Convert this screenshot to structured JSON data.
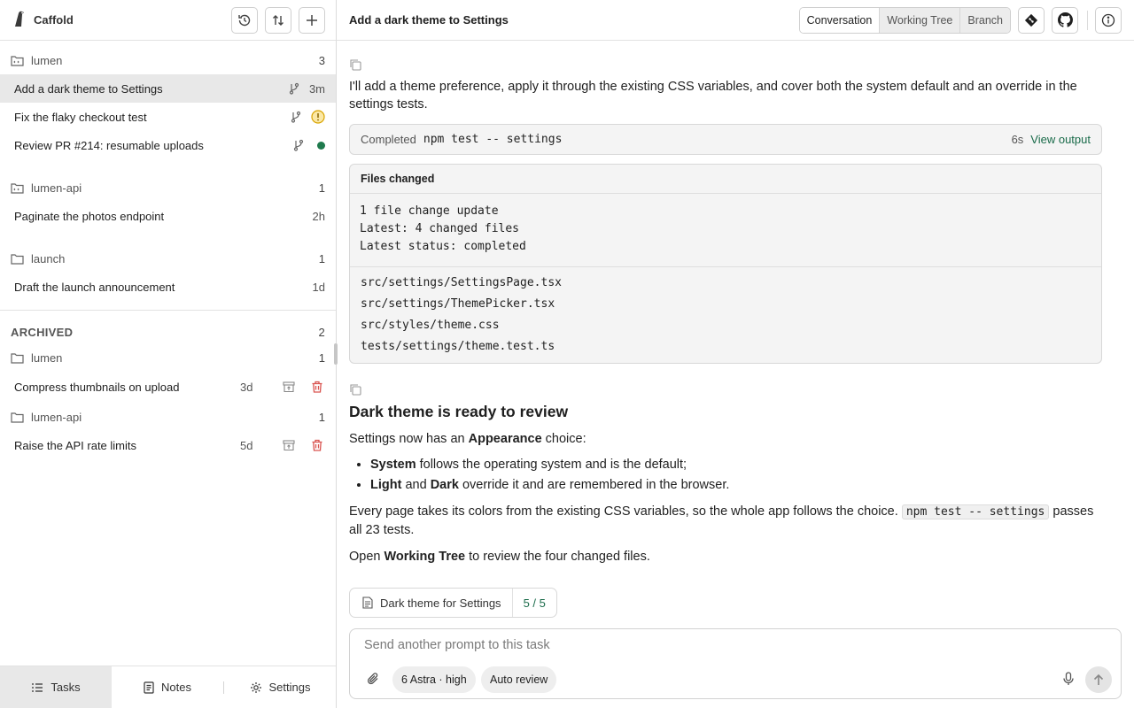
{
  "app": {
    "name": "Caffold"
  },
  "sidebar": {
    "groups": [
      {
        "name": "lumen",
        "count": "3",
        "tasks": [
          {
            "title": "Add a dark theme to Settings",
            "meta": "3m",
            "status": "none"
          },
          {
            "title": "Fix the flaky checkout test",
            "meta": "",
            "status": "warning"
          },
          {
            "title": "Review PR #214: resumable uploads",
            "meta": "",
            "status": "done"
          }
        ]
      },
      {
        "name": "lumen-api",
        "count": "1",
        "tasks": [
          {
            "title": "Paginate the photos endpoint",
            "meta": "2h"
          }
        ]
      },
      {
        "name": "launch",
        "count": "1",
        "tasks": [
          {
            "title": "Draft the launch announcement",
            "meta": "1d"
          }
        ]
      }
    ],
    "archived": {
      "label": "ARCHIVED",
      "count": "2",
      "groups": [
        {
          "name": "lumen",
          "count": "1",
          "tasks": [
            {
              "title": "Compress thumbnails on upload",
              "meta": "3d"
            }
          ]
        },
        {
          "name": "lumen-api",
          "count": "1",
          "tasks": [
            {
              "title": "Raise the API rate limits",
              "meta": "5d"
            }
          ]
        }
      ]
    },
    "footer": {
      "tasks": "Tasks",
      "notes": "Notes",
      "settings": "Settings"
    }
  },
  "header": {
    "title": "Add a dark theme to Settings",
    "tabs": [
      "Conversation",
      "Working Tree",
      "Branch"
    ],
    "active_tab": "Conversation"
  },
  "conversation": {
    "intro": "I'll add a theme preference, apply it through the existing CSS variables, and cover both the system default and an override in the settings tests.",
    "command": {
      "status": "Completed",
      "cmd": "npm test -- settings",
      "time": "6s",
      "link": "View output"
    },
    "files": {
      "header": "Files changed",
      "summary": [
        "1 file change update",
        "Latest: 4 changed files",
        "Latest status: completed"
      ],
      "list": [
        "src/settings/SettingsPage.tsx",
        "src/settings/ThemePicker.tsx",
        "src/styles/theme.css",
        "tests/settings/theme.test.ts"
      ]
    },
    "heading": "Dark theme is ready to review",
    "p1_a": "Settings now has an ",
    "p1_b": "Appearance",
    "p1_c": " choice:",
    "b1_a": "System",
    "b1_b": " follows the operating system and is the default;",
    "b2_a": "Light",
    "b2_b": " and ",
    "b2_c": "Dark",
    "b2_d": " override it and are remembered in the browser.",
    "p2_a": "Every page takes its colors from the existing CSS variables, so the whole app follows the choice. ",
    "p2_code": "npm test -- settings",
    "p2_b": " passes all 23 tests.",
    "p3_a": "Open ",
    "p3_b": "Working Tree",
    "p3_c": " to review the four changed files.",
    "spec": {
      "name": "Dark theme for Settings",
      "progress": "5 / 5"
    }
  },
  "composer": {
    "placeholder": "Send another prompt to this task",
    "value": "",
    "model": "6 Astra  · high",
    "review": "Auto review"
  },
  "colors": {
    "accent_green": "#1a6b4a",
    "warning": "#e0a800",
    "done": "#1f7a4d",
    "delete": "#d9534f"
  }
}
